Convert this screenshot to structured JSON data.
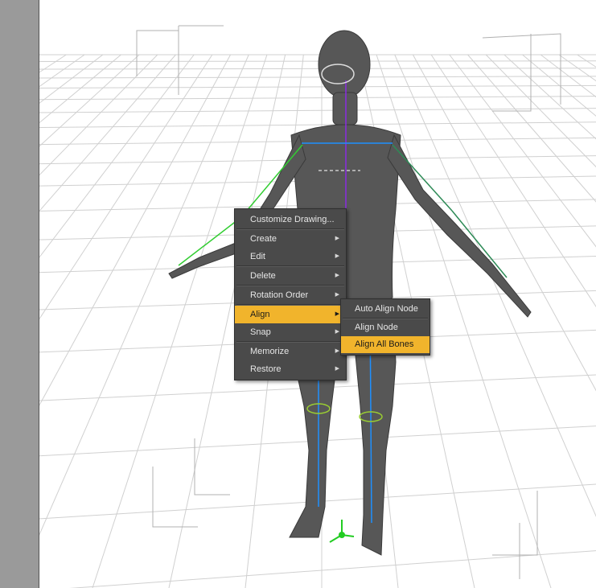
{
  "context_menu": {
    "items": [
      {
        "label": "Customize Drawing...",
        "submenu": false
      },
      {
        "label": "Create",
        "submenu": true
      },
      {
        "label": "Edit",
        "submenu": true
      },
      {
        "label": "Delete",
        "submenu": true
      },
      {
        "label": "Rotation Order",
        "submenu": true
      },
      {
        "label": "Align",
        "submenu": true,
        "highlighted": true
      },
      {
        "label": "Snap",
        "submenu": true
      },
      {
        "label": "Memorize",
        "submenu": true
      },
      {
        "label": "Restore",
        "submenu": true
      }
    ]
  },
  "align_submenu": {
    "items": [
      {
        "label": "Auto Align Node"
      },
      {
        "label": "Align Node"
      },
      {
        "label": "Align All Bones",
        "highlighted": true
      }
    ]
  },
  "colors": {
    "menu_background": "#4a4a4a",
    "menu_text": "#e6e6e6",
    "highlight": "#f1b42c",
    "figure": "#575757",
    "side_panel": "#9a9a9a",
    "grid_lines": "#d0d0d0"
  }
}
